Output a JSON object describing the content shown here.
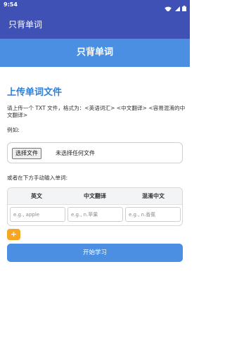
{
  "status_bar": {
    "time": "9:54",
    "icons": [
      "wifi-icon",
      "signal-icon",
      "battery-icon"
    ]
  },
  "app_bar": {
    "title": "只背单词"
  },
  "hero": {
    "title": "只背单词"
  },
  "upload": {
    "title": "上传单词文件",
    "description": "请上传一个 TXT 文件，格式为：<英语词汇> <中文翻译> <容易混淆的中文翻译>",
    "example_label": "例如:",
    "choose_button": "选择文件",
    "no_file_text": "未选择任何文件"
  },
  "manual": {
    "label": "或者在下方手动输入单词:",
    "headers": [
      "英文",
      "中文翻译",
      "混淆中文"
    ],
    "placeholders": [
      "e.g., apple",
      "e.g., n.苹果",
      "e.g., n.香蕉"
    ],
    "add_button": "+"
  },
  "start_button": "开始学习",
  "colors": {
    "status_bar": "#3f51b5",
    "app_bar": "#3f51b5",
    "primary": "#4a8fe2",
    "title_blue": "#2f7ed8",
    "add_button": "#f5a623"
  }
}
